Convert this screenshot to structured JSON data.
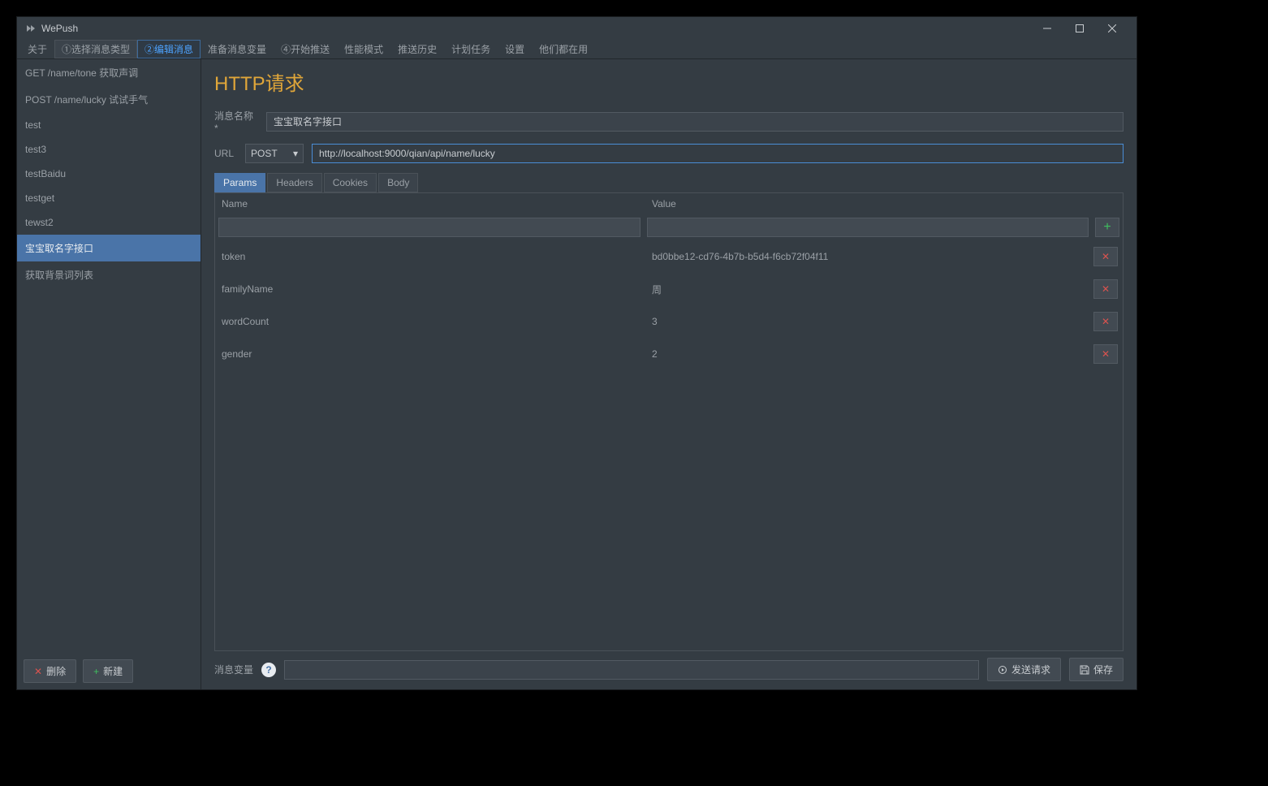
{
  "titlebar": {
    "app_name": "WePush"
  },
  "menubar": {
    "items": [
      {
        "label": "关于",
        "state": ""
      },
      {
        "label": "①选择消息类型",
        "state": "boxed"
      },
      {
        "label": "②编辑消息",
        "state": "active"
      },
      {
        "label": "准备消息变量",
        "state": ""
      },
      {
        "label": "④开始推送",
        "state": ""
      },
      {
        "label": "性能模式",
        "state": ""
      },
      {
        "label": "推送历史",
        "state": ""
      },
      {
        "label": "计划任务",
        "state": ""
      },
      {
        "label": "设置",
        "state": ""
      },
      {
        "label": "他们都在用",
        "state": ""
      }
    ]
  },
  "sidebar": {
    "items": [
      "GET /name/tone 获取声调",
      "POST /name/lucky 试试手气",
      "test",
      "test3",
      "testBaidu",
      "testget",
      "tewst2",
      "宝宝取名字接口",
      "获取背景词列表"
    ],
    "selected_index": 7,
    "delete_label": "删除",
    "new_label": "新建"
  },
  "page": {
    "title": "HTTP请求",
    "msg_name_label": "消息名称 *",
    "msg_name_value": "宝宝取名字接口",
    "url_label": "URL",
    "method": "POST",
    "url_value": "http://localhost:9000/qian/api/name/lucky",
    "tabs": [
      "Params",
      "Headers",
      "Cookies",
      "Body"
    ],
    "active_tab": 0,
    "col_name": "Name",
    "col_value": "Value",
    "params": [
      {
        "name": "token",
        "value": "bd0bbe12-cd76-4b7b-b5d4-f6cb72f04f11"
      },
      {
        "name": "familyName",
        "value": "周"
      },
      {
        "name": "wordCount",
        "value": "3"
      },
      {
        "name": "gender",
        "value": "2"
      }
    ],
    "footer_label": "消息变量",
    "send_label": "发送请求",
    "save_label": "保存"
  }
}
